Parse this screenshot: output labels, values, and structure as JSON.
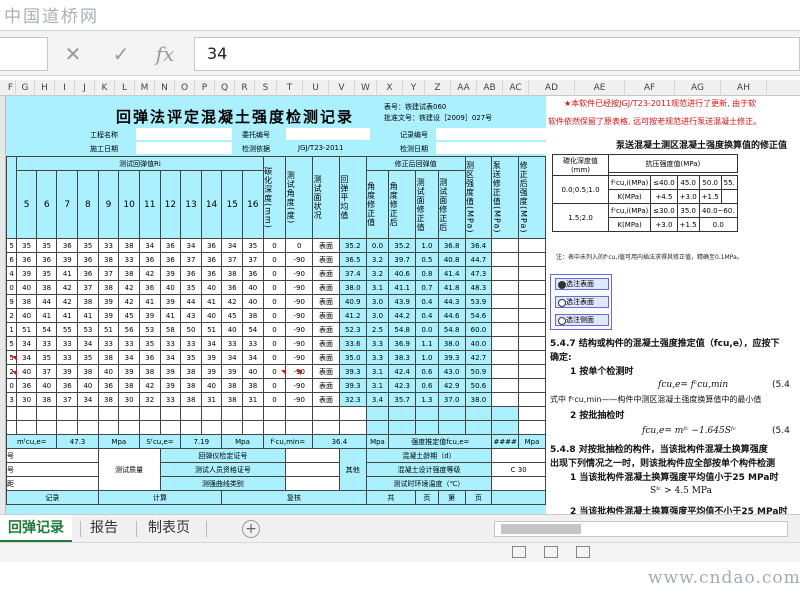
{
  "watermarks": {
    "top": "中国道桥网",
    "bottom": "www.cndao.com"
  },
  "formula_bar": {
    "cancel_icon": "✕",
    "confirm_icon": "✓",
    "fx_label": "fx",
    "value": "34"
  },
  "columns": [
    "F",
    "G",
    "H",
    "I",
    "J",
    "K",
    "L",
    "M",
    "N",
    "O",
    "P",
    "Q",
    "R",
    "S",
    "T",
    "U",
    "V",
    "W",
    "X",
    "Y",
    "Z",
    "AA",
    "AB",
    "AC",
    "AD",
    "AE",
    "AF",
    "AG",
    "AH"
  ],
  "sheet": {
    "title": "回弹法评定混凝土强度检测记录",
    "form_no": "表号：铁建试表060",
    "approval": "批准文号：铁建设［2009］027号",
    "project_name_label": "工程名称",
    "client_no_label": "委托编号",
    "record_no_label": "记录编号",
    "construction_date_label": "施工日期",
    "basis_label": "检测依据",
    "basis_value": "JGJ/T23-2011",
    "test_date_label": "检测日期",
    "rebound_header": "测试回弹值Ri",
    "rebound_cols": [
      "5",
      "6",
      "7",
      "8",
      "9",
      "10",
      "11",
      "12",
      "13",
      "14",
      "15",
      "16"
    ],
    "correction_header": "修正后回弹值",
    "first_col_partial": "值",
    "vert_headers": {
      "carb": "碳化深度(mm)",
      "angle": "测试角度(度)",
      "surface": "测试面状况",
      "avg": "回弹平均值",
      "angcorr": "角度修正值",
      "angcorrd": "角度修正后",
      "surfcorr": "测试面修正值",
      "surfcorrd": "测试面修正后",
      "strength": "测区强度值(MPa)",
      "pump": "泵送修正值(MPa)",
      "pumpcorr": "修正后强度(MPa)"
    },
    "rows": [
      {
        "first": "5",
        "r": [
          "35",
          "35",
          "36",
          "35",
          "33",
          "38",
          "34",
          "36",
          "34",
          "36",
          "34",
          "35"
        ],
        "carb": "0",
        "angle": "0",
        "surf": "表面",
        "avg": "35.2",
        "ac": "0.0",
        "acd": "35.2",
        "sc": "1.0",
        "scd": "36.8",
        "str": "36.4"
      },
      {
        "first": "6",
        "r": [
          "36",
          "36",
          "39",
          "36",
          "38",
          "33",
          "36",
          "36",
          "37",
          "36",
          "37",
          "37"
        ],
        "carb": "0",
        "angle": "-90",
        "surf": "表面",
        "avg": "36.5",
        "ac": "3.2",
        "acd": "39.7",
        "sc": "0.5",
        "scd": "40.8",
        "str": "44.7"
      },
      {
        "first": "4",
        "r": [
          "39",
          "35",
          "41",
          "36",
          "37",
          "38",
          "42",
          "39",
          "36",
          "36",
          "38",
          "36"
        ],
        "carb": "0",
        "angle": "-90",
        "surf": "表面",
        "avg": "37.4",
        "ac": "3.2",
        "acd": "40.6",
        "sc": "0.8",
        "scd": "41.4",
        "str": "47.3"
      },
      {
        "first": "0",
        "r": [
          "40",
          "38",
          "42",
          "37",
          "38",
          "42",
          "36",
          "40",
          "35",
          "40",
          "36",
          "40"
        ],
        "carb": "0",
        "angle": "-90",
        "surf": "表面",
        "avg": "38.0",
        "ac": "3.1",
        "acd": "41.1",
        "sc": "0.7",
        "scd": "41.8",
        "str": "48.3"
      },
      {
        "first": "9",
        "r": [
          "38",
          "44",
          "42",
          "38",
          "39",
          "42",
          "41",
          "39",
          "44",
          "41",
          "42",
          "40"
        ],
        "carb": "0",
        "angle": "-90",
        "surf": "表面",
        "avg": "40.9",
        "ac": "3.0",
        "acd": "43.9",
        "sc": "0.4",
        "scd": "44.3",
        "str": "53.9"
      },
      {
        "first": "2",
        "r": [
          "40",
          "41",
          "41",
          "41",
          "39",
          "45",
          "39",
          "41",
          "43",
          "40",
          "45",
          "38"
        ],
        "carb": "0",
        "angle": "-90",
        "surf": "表面",
        "avg": "41.2",
        "ac": "3.0",
        "acd": "44.2",
        "sc": "0.4",
        "scd": "44.6",
        "str": "54.6"
      },
      {
        "first": "1",
        "r": [
          "51",
          "54",
          "55",
          "53",
          "51",
          "56",
          "53",
          "58",
          "50",
          "51",
          "40",
          "54"
        ],
        "carb": "0",
        "angle": "-90",
        "surf": "表面",
        "avg": "52.3",
        "ac": "2.5",
        "acd": "54.8",
        "sc": "0.0",
        "scd": "54.8",
        "str": "60.0"
      },
      {
        "first": "5",
        "r": [
          "34",
          "33",
          "33",
          "34",
          "33",
          "33",
          "35",
          "33",
          "33",
          "34",
          "33",
          "33"
        ],
        "carb": "0",
        "angle": "-90",
        "surf": "表面",
        "avg": "33.6",
        "ac": "3.3",
        "acd": "36.9",
        "sc": "1.1",
        "scd": "38.0",
        "str": "40.0"
      },
      {
        "first": "5",
        "r": [
          "34",
          "35",
          "33",
          "35",
          "38",
          "34",
          "36",
          "34",
          "35",
          "39",
          "34",
          "34"
        ],
        "carb": "0",
        "angle": "-90",
        "surf": "表面",
        "avg": "35.0",
        "ac": "3.3",
        "acd": "38.3",
        "sc": "1.0",
        "scd": "39.3",
        "str": "42.7"
      },
      {
        "first": "2",
        "r": [
          "40",
          "37",
          "39",
          "38",
          "40",
          "39",
          "38",
          "39",
          "38",
          "39",
          "39",
          "40"
        ],
        "carb": "0",
        "angle": "-90",
        "surf": "表面",
        "avg": "39.3",
        "ac": "3.1",
        "acd": "42.4",
        "sc": "0.6",
        "scd": "43.0",
        "str": "50.9"
      },
      {
        "first": "0",
        "r": [
          "36",
          "40",
          "36",
          "40",
          "36",
          "38",
          "42",
          "39",
          "38",
          "40",
          "38",
          "38"
        ],
        "carb": "0",
        "angle": "-90",
        "surf": "表面",
        "avg": "39.3",
        "ac": "3.1",
        "acd": "42.3",
        "sc": "0.6",
        "scd": "42.9",
        "str": "50.6"
      },
      {
        "first": "3",
        "r": [
          "30",
          "38",
          "37",
          "34",
          "38",
          "30",
          "32",
          "33",
          "38",
          "31",
          "38",
          "31"
        ],
        "carb": "0",
        "angle": "-90",
        "surf": "表面",
        "avg": "32.3",
        "ac": "3.4",
        "acd": "35.7",
        "sc": "1.3",
        "scd": "37.0",
        "str": "38.0"
      }
    ],
    "summary": {
      "m_label": "mᶠcu,e=",
      "m_value": "47.3",
      "m_unit": "Mpa",
      "s_label": "Sᶠcu,e=",
      "s_value": "7.19",
      "s_unit": "Mpa",
      "min_label": "fᶜcu,min=",
      "min_value": "36.4",
      "min_unit": "Mpa",
      "est_label": "强度推定值fcu,e=",
      "est_value": "####",
      "est_unit": "Mpa"
    },
    "bottom": {
      "row1_left": "号",
      "row2_left": "号",
      "row3_left": "距",
      "quality_label": "测试质量",
      "calib_label": "回弹仪检定证号",
      "person_label": "测试人员资格证号",
      "curve_label": "测强曲线类别",
      "other_label": "其他",
      "age_label": "混凝土龄期（d）",
      "grade_label": "混凝土设计强度等级",
      "grade_value": "C 30",
      "temp_label": "测试时环境温度（℃）",
      "footer1": "记录",
      "footer2": "计算",
      "footer3": "复核",
      "footer4": "共",
      "footer5": "页",
      "footer6": "第",
      "footer7": "页"
    }
  },
  "right_panel": {
    "red_line1": "★本软件已经按JGJ/T23-2011规范进行了更新, 由于软",
    "red_line2": "软件依然保留了原表格, 远可按老规范进行泵送混凝土修正。",
    "table_title": "泵送混凝土测区混凝土强度换算值的修正值",
    "th_carb": "碳化深度值",
    "th_unit": "(mm)",
    "th_strength": "抗压强度值(MPa)",
    "r1_range": "0.0;0.5;1.0",
    "r1_fcu": "fᶜcu,i(MPa)",
    "r1_k": "K(MPa)",
    "r1_v1": "≤40.0",
    "r1_v2": "45.0",
    "r1_v3": "50.0",
    "r1_v4": "55.",
    "r1_k1": "+4.5",
    "r1_k2": "+3.0",
    "r1_k3": "+1.5",
    "r2_range": "1.5;2.0",
    "r2_fcu": "fᶜcu,i(MPa)",
    "r2_k": "K(MPa)",
    "r2_v1": "≤30.0",
    "r2_v2": "35.0",
    "r2_v3": "40.0~60.",
    "r2_k1": "+3.0",
    "r2_k2": "+1.5",
    "r2_k3": "0.0",
    "note": "注：表中未列入的fᶜcu,i值可用内插法求得其修正值，精确至0.1MPa。",
    "options": [
      "选注表面",
      "选注表面",
      "选注侧面"
    ],
    "doc_547": "5.4.7  结构或构件的混凝土强度推定值（fcu,e），应按下",
    "doc_547b": "确定:",
    "doc_item1": "1   按单个检测时",
    "doc_f1": "fcu,e= fᶜcu,min",
    "doc_num": "(5.4",
    "doc_where": "式中   fᶜcu,min——构件中测区混凝土强度换算值中的最小值",
    "doc_item2": "2   按批抽检时",
    "doc_f2": "fcu,e= mᶠᶜ −1.645Sᶠᶜ",
    "doc_548": "5.4.8  对按批抽检的构件，当该批构件混凝土换算强度",
    "doc_548b": "出现下列情况之一时，则该批构件应全部按单个构件检测",
    "doc_c1": "1   当该批构件混凝土换算强度平均值小于25 MPa时",
    "doc_c1b": "Sᶠᶜ > 4.5 MPa",
    "doc_c2": "2   当该批构件混凝土换算强度平均值不小于25 MPa时"
  },
  "tabs": [
    "回弹记录",
    "报告",
    "制表页"
  ],
  "add_sheet_icon": "+"
}
